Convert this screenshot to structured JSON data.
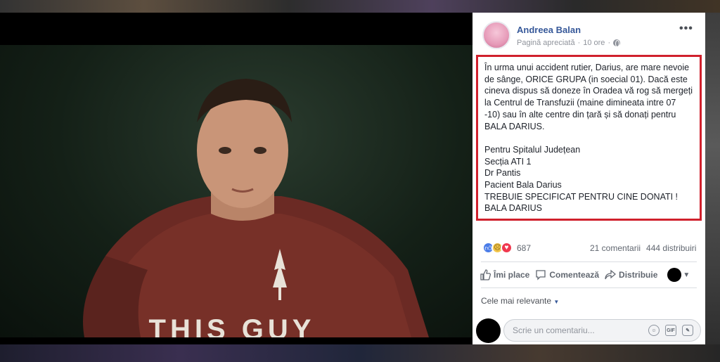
{
  "author": {
    "name": "Andreea Balan",
    "meta_page": "Pagină apreciată",
    "meta_time": "10 ore"
  },
  "post": {
    "text": "În urma unui accident rutier, Darius, are mare nevoie de sânge, ORICE GRUPA (in soecial 01). Dacă este cineva dispus să doneze în Oradea vă rog să mergeți la Centrul de Transfuzii (maine dimineata intre 07 -10) sau în alte centre din țară și să donați pentru BALA DARIUS.\n\nPentru Spitalul Județean\nSecția ATI 1\nDr Pantis\nPacient Bala Darius\nTREBUIE SPECIFICAT PENTRU CINE DONATI !\nBALA DARIUS"
  },
  "engagement": {
    "reaction_count": "687",
    "comments": "21 comentarii",
    "shares": "444 distribuiri"
  },
  "actions": {
    "like": "Îmi place",
    "comment": "Comentează",
    "share": "Distribuie"
  },
  "comments_filter": "Cele mai relevante",
  "comment_input": {
    "placeholder": "Scrie un comentariu..."
  },
  "photo": {
    "shirt_text": "THIS GUY"
  },
  "colors": {
    "link": "#365899",
    "highlight_border": "#d0202c",
    "text": "#1d2129"
  }
}
